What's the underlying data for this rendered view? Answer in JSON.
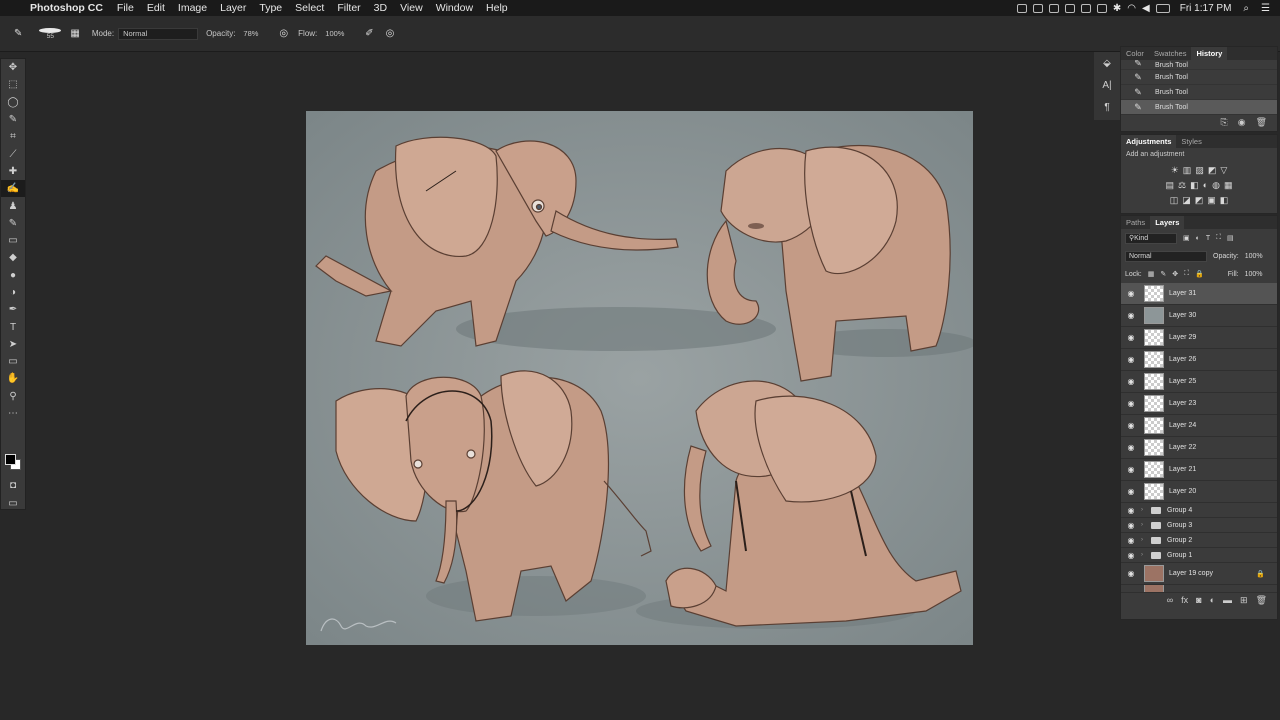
{
  "menubar": {
    "app_name": "Photoshop CC",
    "menus": [
      "File",
      "Edit",
      "Image",
      "Layer",
      "Type",
      "Select",
      "Filter",
      "3D",
      "View",
      "Window",
      "Help"
    ],
    "clock": "Fri 1:17 PM"
  },
  "options": {
    "brush_size": "55",
    "mode_label": "Mode:",
    "mode_value": "Normal",
    "opacity_label": "Opacity:",
    "opacity_value": "78%",
    "flow_label": "Flow:",
    "flow_value": "100%"
  },
  "history_panel": {
    "tabs": [
      "Color",
      "Swatches",
      "History"
    ],
    "items": [
      "Brush Tool",
      "Brush Tool",
      "Brush Tool",
      "Brush Tool"
    ]
  },
  "adjustments_panel": {
    "tabs": [
      "Adjustments",
      "Styles"
    ],
    "hint": "Add an adjustment"
  },
  "layers_panel": {
    "tabs": [
      "Paths",
      "Layers"
    ],
    "filter_label": "Kind",
    "blend_mode": "Normal",
    "opacity_label": "Opacity:",
    "opacity_value": "100%",
    "lock_label": "Lock:",
    "fill_label": "Fill:",
    "fill_value": "100%",
    "layers": [
      "Layer 31",
      "Layer 30",
      "Layer 29",
      "Layer 26",
      "Layer 25",
      "Layer 23",
      "Layer 24",
      "Layer 22",
      "Layer 21",
      "Layer 20"
    ],
    "groups": [
      "Group 4",
      "Group 3",
      "Group 2",
      "Group 1"
    ],
    "bottom_layer": "Layer 19 copy"
  },
  "icons": {
    "apple": "apple-icon",
    "brush": "brush-icon",
    "eye": "eye-icon",
    "lock": "lock-icon",
    "folder": "folder-icon"
  },
  "colors": {
    "canvas_bg": "#8c9698",
    "elephant_skin": "#c49b86",
    "ui_dark": "#282828"
  }
}
